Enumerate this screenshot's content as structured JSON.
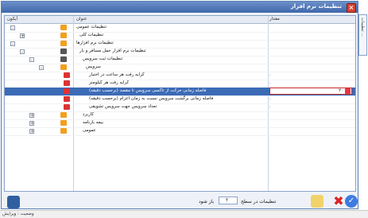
{
  "window": {
    "title": "تنظیمات نرم افزار"
  },
  "side_tab": {
    "label": "تنظیمات ... "
  },
  "columns": {
    "icon": "آیکون",
    "title": "عنوان",
    "value": "مقدار"
  },
  "rows": [
    {
      "label": "تنظیمات عمومی",
      "exp": "-",
      "value": ""
    },
    {
      "label": "تنظیمات کلی",
      "exp": "+",
      "value": ""
    },
    {
      "label": "تنظیمات نرم افزارها",
      "exp": "-",
      "value": ""
    },
    {
      "label": "تنظیمات نرم افزار حمل مسافر و بار",
      "exp": "-",
      "value": ""
    },
    {
      "label": "تنظیمات ثبت سرویس",
      "exp": "-",
      "value": ""
    },
    {
      "label": "سرویس",
      "exp": "-",
      "value": ""
    },
    {
      "label": "کرایه رفت هر ساعت در اختیار",
      "exp": "",
      "value": "."
    },
    {
      "label": "کرایه رفت هر کیلومتر",
      "exp": "",
      "value": "."
    },
    {
      "label": "فاصله زمانی حرکت از تاکسی سرویس تا مقصد (برحسب دقیقه)",
      "exp": "",
      "value": "۲۰"
    },
    {
      "label": "فاصله زمانی برگشت سرویس نسبت به زمان اعزام (برحسب دقیقه)",
      "exp": "",
      "value": "."
    },
    {
      "label": "تعداد سرویس جهت سرویس تشویقی",
      "exp": "",
      "value": "."
    },
    {
      "label": "کاربرد",
      "exp": "+",
      "value": ""
    },
    {
      "label": "بیمه بازنامه",
      "exp": "+",
      "value": ""
    },
    {
      "label": "عمومی",
      "exp": "+",
      "value": ""
    }
  ],
  "bottom": {
    "level_label": "تنظیمات در سطح",
    "level_value": "۲",
    "open_label": "باز شود"
  },
  "status": {
    "text": "وضعیت : ویرایش"
  },
  "colors": {
    "accent": "#3c6bb6",
    "title": "#3f67ab"
  }
}
